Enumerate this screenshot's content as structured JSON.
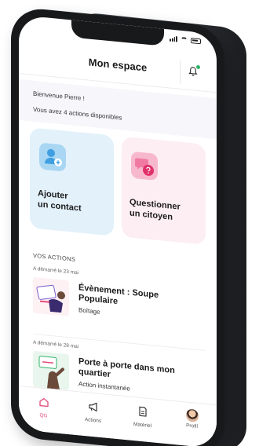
{
  "header": {
    "title": "Mon espace"
  },
  "welcome": {
    "greeting": "Bienvenue Pierre !",
    "available_actions": "Vous avez 4 actions disponibles"
  },
  "quick_actions": [
    {
      "label_line1": "Ajouter",
      "label_line2": "un contact",
      "icon": "add-contact-icon"
    },
    {
      "label_line1": "Questionner",
      "label_line2": "un citoyen",
      "icon": "chat-bubbles-icon"
    }
  ],
  "actions": {
    "section_title": "VOS ACTIONS",
    "items": [
      {
        "started": "A démarré le 23 mai",
        "title_line1": "Évènement : Soupe",
        "title_line2": "Populaire",
        "subtitle": "Boîtage"
      },
      {
        "started": "A démarré le 28 mai",
        "title_line1": "Porte à porte dans mon",
        "title_line2": "quartier",
        "subtitle": "Action instantanée"
      }
    ]
  },
  "bottom_nav": [
    {
      "label": "QG",
      "icon": "home-icon",
      "active": true
    },
    {
      "label": "Actions",
      "icon": "megaphone-icon",
      "active": false
    },
    {
      "label": "Matériel",
      "icon": "document-icon",
      "active": false
    },
    {
      "label": "Profil",
      "icon": "avatar",
      "active": false
    }
  ],
  "colors": {
    "accent": "#e24b7a",
    "contact_card": "#e3f1fb",
    "question_card": "#fdeef3",
    "notification_dot": "#2fb36a"
  }
}
